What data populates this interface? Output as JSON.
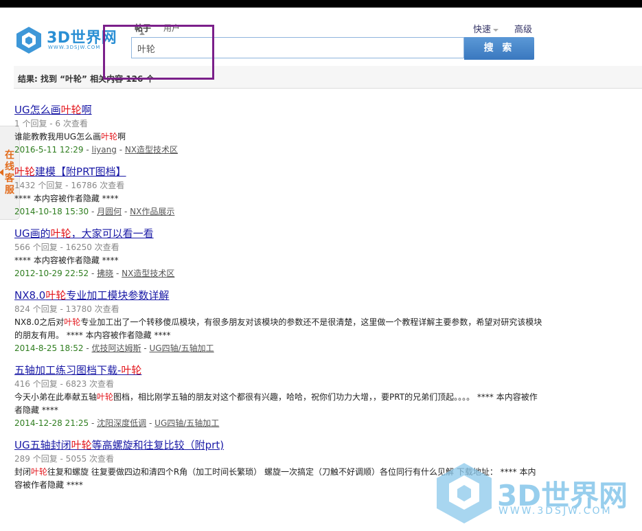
{
  "logo": {
    "text": "3D世界网",
    "sub": "WWW.3DSJW.COM"
  },
  "tabs": {
    "active": "帖子",
    "user": "用户"
  },
  "search": {
    "value": "叶轮",
    "button": "搜 索"
  },
  "header_links": {
    "quick": "快速",
    "advanced": "高级"
  },
  "result_summary": "结果: 找到 “叶轮” 相关内容 126 个",
  "kefu": [
    "在",
    "线",
    "客",
    "服"
  ],
  "colors": {
    "accent": "#2a8fd4",
    "highlight": "#e3161c",
    "link": "#1a1aa6",
    "date": "#2e7d1e",
    "annotation_box": "#7b1f8a"
  },
  "results": [
    {
      "title": [
        "UG怎么画",
        "叶轮",
        "啊"
      ],
      "meta": "1 个回复 - 6 次查看",
      "desc": [
        "谁能教教我用UG怎么画",
        "叶轮",
        "啊"
      ],
      "date": "2016-5-11 12:29",
      "author": "liyang",
      "forum": "NX造型技术区"
    },
    {
      "title": [
        "叶",
        "轮",
        "建模【附PRT图档】"
      ],
      "meta": "1432 个回复 - 16786 次查看",
      "desc": [
        "**** 本内容被作者隐藏 ****",
        "",
        ""
      ],
      "date": "2014-10-18 15:30",
      "author": "月圆何",
      "forum": "NX作品展示"
    },
    {
      "title": [
        "UG画的",
        "叶轮",
        "，大家可以看一看"
      ],
      "meta": "566 个回复 - 16250 次查看",
      "desc": [
        "**** 本内容被作者隐藏 ****",
        "",
        ""
      ],
      "date": "2012-10-29 22:52",
      "author": "拂晓",
      "forum": "NX造型技术区"
    },
    {
      "title": [
        "NX8.0",
        "叶轮",
        "专业加工模块参数详解"
      ],
      "meta": "824 个回复 - 13780 次查看",
      "desc": [
        "NX8.0之后对",
        "叶轮",
        "专业加工出了一个转移傻瓜模块，有很多朋友对该模块的参数还不是很清楚，这里做一个教程详解主要参数，希望对研究该模块的朋友有用。 **** 本内容被作者隐藏 ****"
      ],
      "date": "2014-8-25 18:52",
      "author": "优技阿达姆斯",
      "forum": "UG四轴/五轴加工"
    },
    {
      "title": [
        "五轴加工练习图档下载-",
        "叶轮",
        ""
      ],
      "meta": "416 个回复 - 6823 次查看",
      "desc": [
        "今天小弟在此奉献五轴",
        "叶轮",
        "图档，相比刚学五轴的朋友对这个都很有兴趣，哈哈，祝你们功力大增，，要PRT的兄弟们顶起。。。。 **** 本内容被作者隐藏 ****"
      ],
      "date": "2014-12-28 21:25",
      "author": "沈阳深度低调",
      "forum": "UG四轴/五轴加工"
    },
    {
      "title": [
        "UG五轴封闭",
        "叶轮",
        "等高螺旋和往复比较（附prt)"
      ],
      "meta": "289 个回复 - 5055 次查看",
      "desc": [
        "封闭",
        "叶轮",
        "往复和螺旋 往复要做四边和清四个R角（加工时间长繁琐） 螺旋一次搞定（刀触不好调顺）各位同行有什么见解 下载地址： **** 本内容被作者隐藏 ****"
      ],
      "date": "",
      "author": "",
      "forum": ""
    }
  ],
  "watermark": {
    "text": "3D世界网",
    "sub": "WWW.3DSJW.COM"
  }
}
